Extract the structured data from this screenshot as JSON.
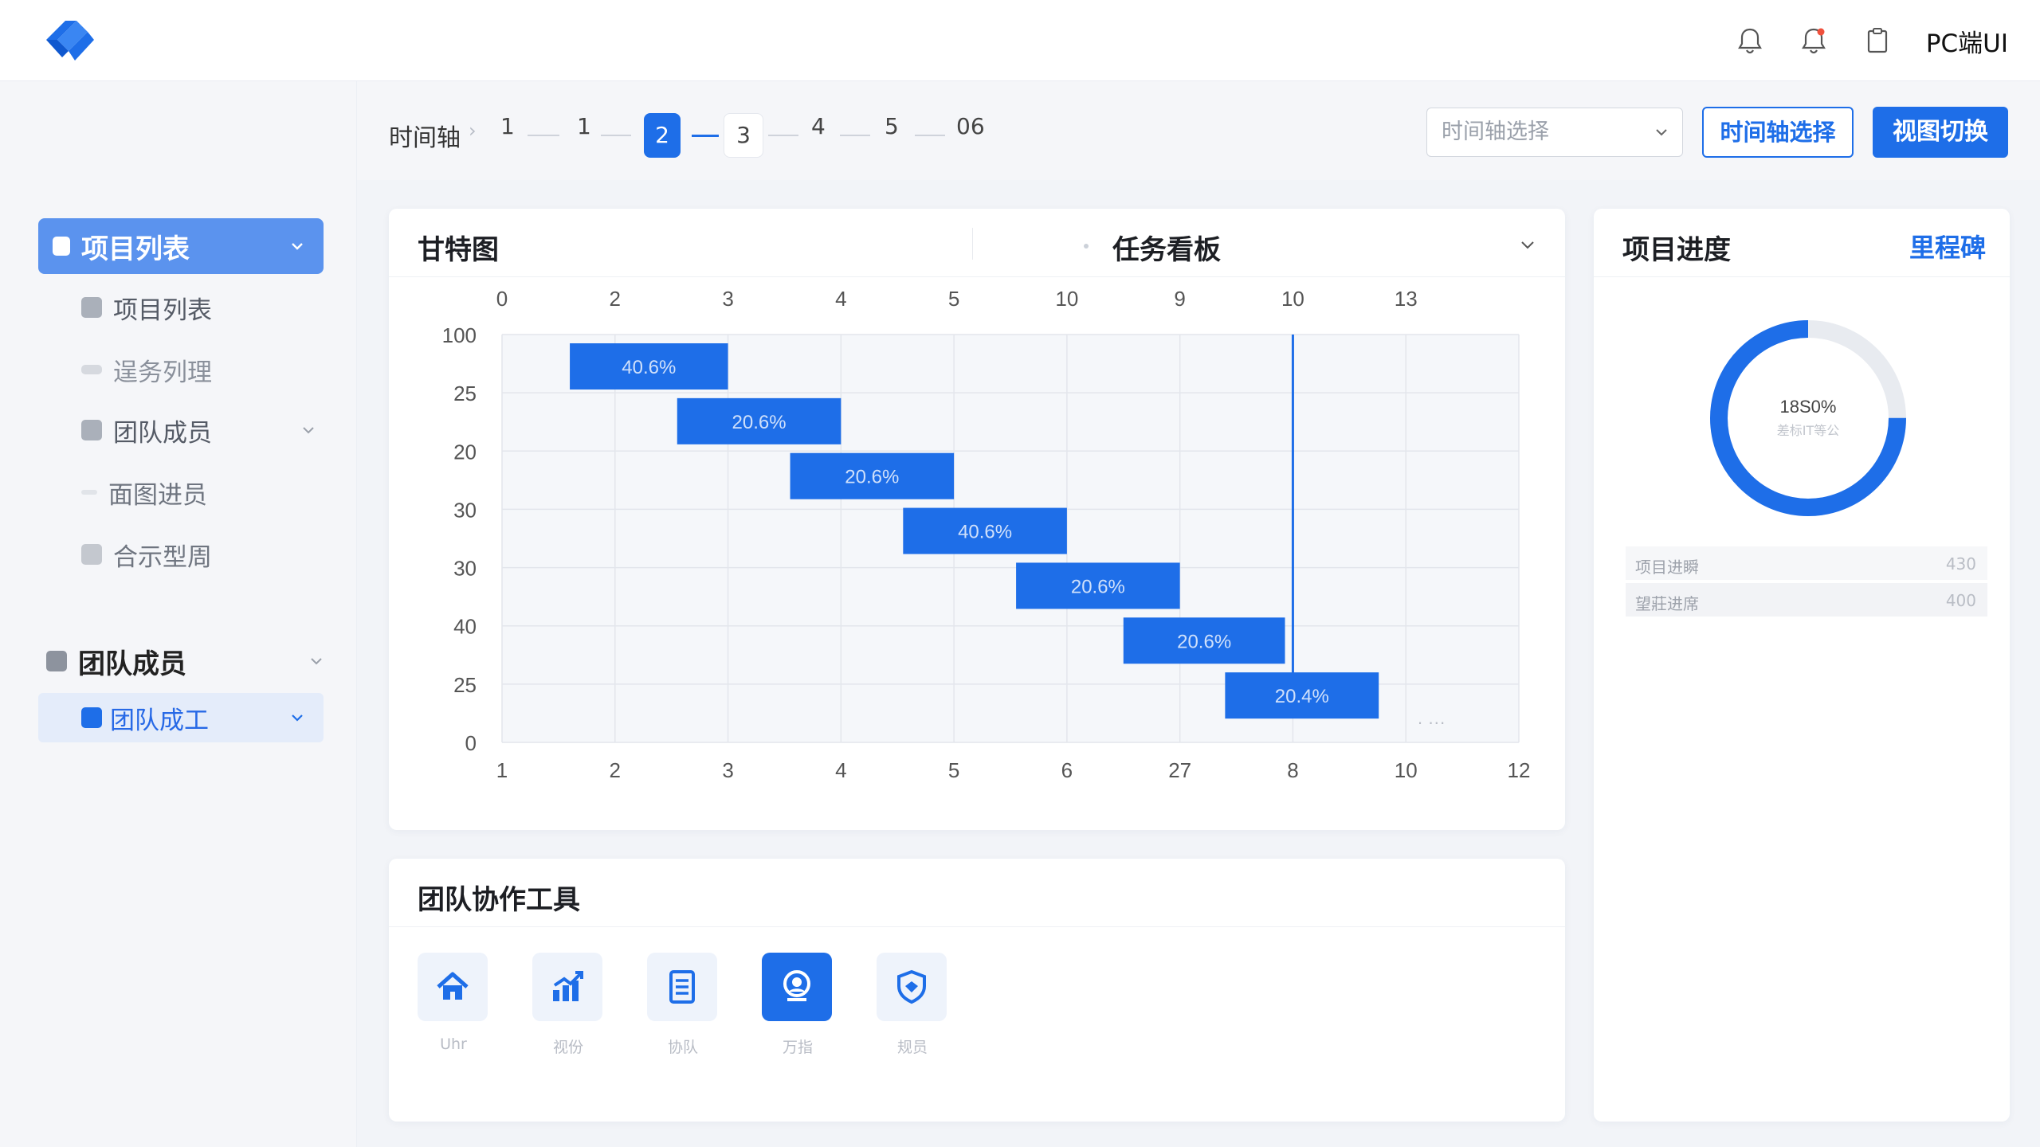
{
  "header": {
    "brand_label": "PC端UI",
    "icons": [
      "bell-icon",
      "notification-bell-icon",
      "clipboard-icon"
    ]
  },
  "sidebar": {
    "active_section": {
      "label": "项目列表"
    },
    "items": [
      {
        "label": "项目列表"
      },
      {
        "label": "逞务列理"
      },
      {
        "label": "团队成员"
      },
      {
        "label": "面图进员"
      },
      {
        "label": "合示型周"
      }
    ],
    "group": {
      "label": "团队成员"
    },
    "group_active_item": {
      "label": "团队成工"
    }
  },
  "timeline": {
    "label": "时间轴",
    "steps": [
      "1",
      "1",
      "2",
      "3",
      "4",
      "5",
      "06"
    ],
    "active_step": "2",
    "select_placeholder": "时间轴选择",
    "select_button": "时间轴选择",
    "view_button": "视图切换"
  },
  "gantt_card": {
    "title": "甘特图",
    "tab2_label": "任务看板"
  },
  "chart_data": {
    "type": "gantt",
    "x_top_ticks": [
      "0",
      "2",
      "3",
      "4",
      "5",
      "10",
      "9",
      "10",
      "13"
    ],
    "x_bottom_ticks": [
      "1",
      "2",
      "3",
      "4",
      "5",
      "6",
      "27",
      "8",
      "10",
      "12"
    ],
    "y_ticks": [
      "100",
      "25",
      "20",
      "30",
      "30",
      "40",
      "25",
      "0"
    ],
    "tasks": [
      {
        "start": 1.6,
        "end": 3.0,
        "label": "40.6%"
      },
      {
        "start": 2.55,
        "end": 4.0,
        "label": "20.6%"
      },
      {
        "start": 3.55,
        "end": 5.0,
        "label": "20.6%"
      },
      {
        "start": 4.55,
        "end": 6.0,
        "label": "40.6%"
      },
      {
        "start": 5.55,
        "end": 7.0,
        "label": "20.6%"
      },
      {
        "start": 6.5,
        "end": 7.93,
        "label": "20.6%"
      },
      {
        "start": 7.4,
        "end": 8.76,
        "label": "20.4%"
      }
    ],
    "marker_x": 8,
    "grid": true,
    "trailing_text": "· ···",
    "colors": {
      "bar": "#1e6ee8",
      "grid": "#e3e6ec",
      "plot_bg": "#f5f7fa",
      "marker": "#1e6ee8"
    }
  },
  "tools_card": {
    "title": "团队协作工具",
    "tools": [
      {
        "label": "Uhr",
        "icon": "home-icon",
        "active": false
      },
      {
        "label": "视份",
        "icon": "bar-chart-icon",
        "active": false
      },
      {
        "label": "协队",
        "icon": "document-icon",
        "active": false
      },
      {
        "label": "万指",
        "icon": "user-profile-icon",
        "active": true
      },
      {
        "label": "规员",
        "icon": "shield-icon",
        "active": false
      }
    ]
  },
  "progress_card": {
    "title": "项目进度",
    "milestone_link": "里程碑",
    "donut": {
      "value_text": "18S0%",
      "sub_text": "差标IT等公",
      "fraction": 0.75,
      "color": "#1e6ee8",
      "track": "#e8ebf0"
    },
    "stats": [
      {
        "label": "项目进瞬",
        "value": "430"
      },
      {
        "label": "望莊进席",
        "value": "400"
      }
    ]
  }
}
